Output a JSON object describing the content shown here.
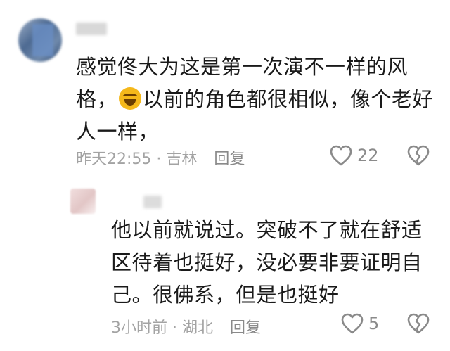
{
  "comments": [
    {
      "text_before_emoji": "感觉佟大为这是第一次演不一样的风格，",
      "emoji": "laughing-crying-emoji",
      "text_after_emoji": "以前的角色都很相似，像个老好人一样，",
      "meta": "昨天22:55 · 吉林",
      "reply_label": "回复",
      "like_count": "22"
    },
    {
      "text": "他以前就说过。突破不了就在舒适区待着也挺好，没必要非要证明自己。很佛系，但是也挺好",
      "meta": "3小时前 · 湖北",
      "reply_label": "回复",
      "like_count": "5"
    }
  ]
}
